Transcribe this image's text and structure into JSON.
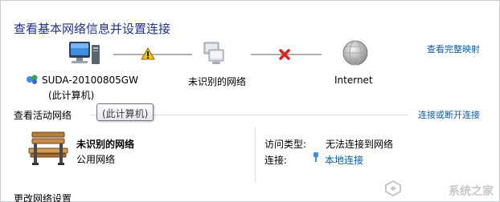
{
  "page": {
    "title": "查看基本网络信息并设置连接",
    "view_full_map": "查看完整映射"
  },
  "map": {
    "computer_name": "SUDA-20100805GW",
    "computer_sub": "(此计算机)",
    "network_name": "未识别的网络",
    "internet_label": "Internet"
  },
  "active": {
    "section_label": "查看活动网络",
    "connect_link": "连接或断开连接",
    "tooltip": "(此计算机)",
    "network_name": "未识别的网络",
    "network_type": "公用网络",
    "access_label": "访问类型:",
    "access_value": "无法连接到网络",
    "connection_label": "连接:",
    "connection_value": "本地连接"
  },
  "bottom": {
    "change_settings": "更改网络设置"
  },
  "watermark": {
    "text": "系统之家"
  },
  "colors": {
    "title": "#1e3287",
    "link": "#0b5aa6",
    "warning": "#f2c200",
    "error": "#d9261c"
  },
  "icons": [
    "computer-icon",
    "warning-icon",
    "network-icon",
    "error-x-icon",
    "globe-icon",
    "network-shield-icon",
    "bench-icon",
    "local-connection-icon"
  ]
}
